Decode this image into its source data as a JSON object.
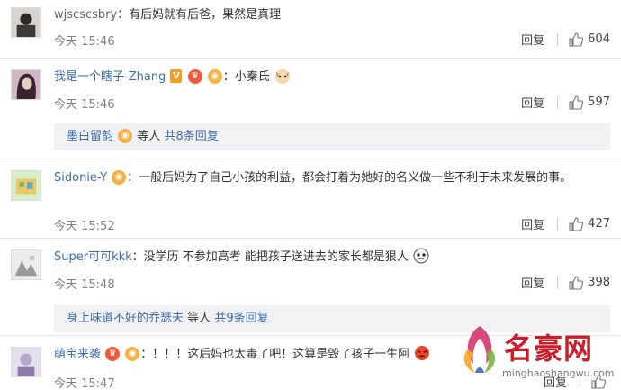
{
  "comments": [
    {
      "user": "wjscscsbry",
      "text": "：有后妈就有后爸，果然是真理",
      "time": "今天 15:46",
      "reply": "回复",
      "likes": "604"
    },
    {
      "user": "我是一个瞎子-Zhang",
      "text": "：小秦氏",
      "time": "今天 15:46",
      "reply": "回复",
      "likes": "597",
      "sub": {
        "name": "墨白留韵",
        "suffix": "等人",
        "count": "共8条回复"
      }
    },
    {
      "user": "Sidonie-Y",
      "text": "：一般后妈为了自己小孩的利益，都会打着为她好的名义做一些不利于未来发展的事。",
      "time": "今天 15:52",
      "reply": "回复",
      "likes": "427"
    },
    {
      "user": "Super可可kkk",
      "text": "：没学历 不参加高考 能把孩子送进去的家长都是狠人",
      "time": "今天 15:48",
      "reply": "回复",
      "likes": "398",
      "sub": {
        "name": "身上味道不好的乔瑟夫",
        "suffix": "等人",
        "count": "共9条回复"
      }
    },
    {
      "user": "萌宝来袭",
      "text": "：！！！这后妈也太毒了吧！这算是毁了孩子一生阿",
      "time": "今天 15:47",
      "reply": "回复",
      "likes": ""
    }
  ],
  "badges": {
    "vip": "V"
  },
  "watermark": {
    "name": "名豪网",
    "url": "minghaoshangwu.com"
  },
  "colors": {
    "username": "#3d6ca8",
    "meta": "#808080",
    "subreply_bg": "#f2f2f5",
    "watermark": "#c81f2a"
  },
  "icons": [
    "thumb-up-icon",
    "vip-badge-icon",
    "crown-badge-icon",
    "ring-badge-icon",
    "cat-emoji-icon",
    "face-emoji-icon",
    "angry-emoji-icon"
  ]
}
